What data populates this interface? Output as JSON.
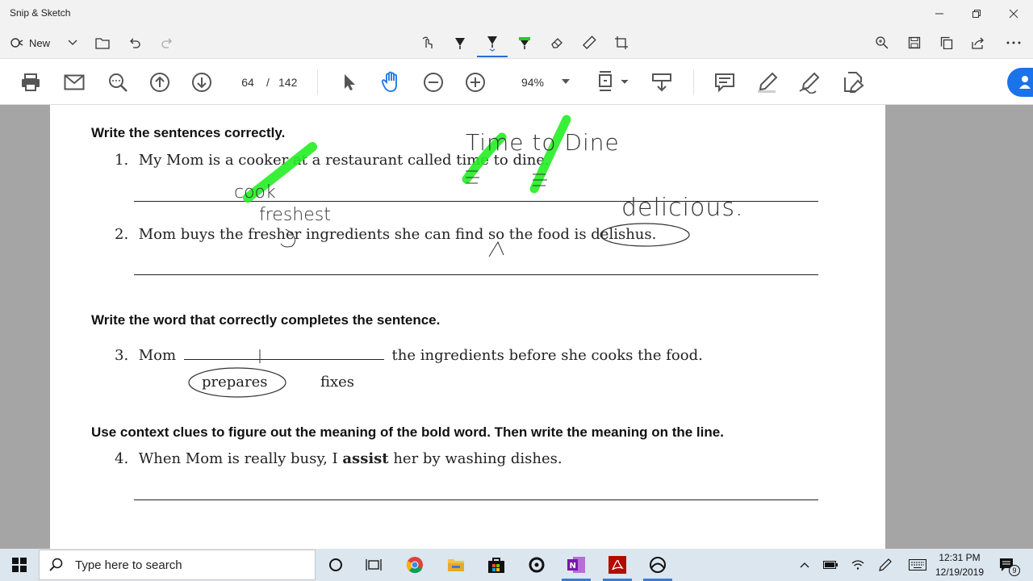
{
  "app": {
    "title": "Snip & Sketch",
    "new_label": "New"
  },
  "acrobat": {
    "page_current": "64",
    "page_separator": "/",
    "page_total": "142",
    "zoom": "94%"
  },
  "worksheet": {
    "heading1": "Write the sentences correctly.",
    "q1_num": "1.",
    "q1_text": "My Mom is a cooker at a restaurant called time to dine.",
    "q2_num": "2.",
    "q2_text": "Mom buys the fresher ingredients she can find so the food is delishus.",
    "heading2": "Write the word that correctly completes the sentence.",
    "q3_num": "3.",
    "q3_before": "Mom",
    "q3_after": "the ingredients before she cooks the food.",
    "q3_option1": "prepares",
    "q3_option2": "fixes",
    "heading3": "Use context clues to figure out the meaning of the bold word. Then write the meaning on the line.",
    "q4_num": "4.",
    "q4_before": "When Mom is really busy, I",
    "q4_bold": "assist",
    "q4_after": "her by washing dishes."
  },
  "handwriting": {
    "time_to_dine": "Time to Dine",
    "cook": "cook",
    "freshest": "freshest",
    "delicious": "delicious."
  },
  "taskbar": {
    "search_placeholder": "Type here to search",
    "time": "12:31 PM",
    "date": "12/19/2019",
    "notification_count": "9"
  },
  "colors": {
    "highlighter": "#22ee22",
    "accent": "#2a6dd6",
    "taskbar": "#dbe6ee"
  }
}
